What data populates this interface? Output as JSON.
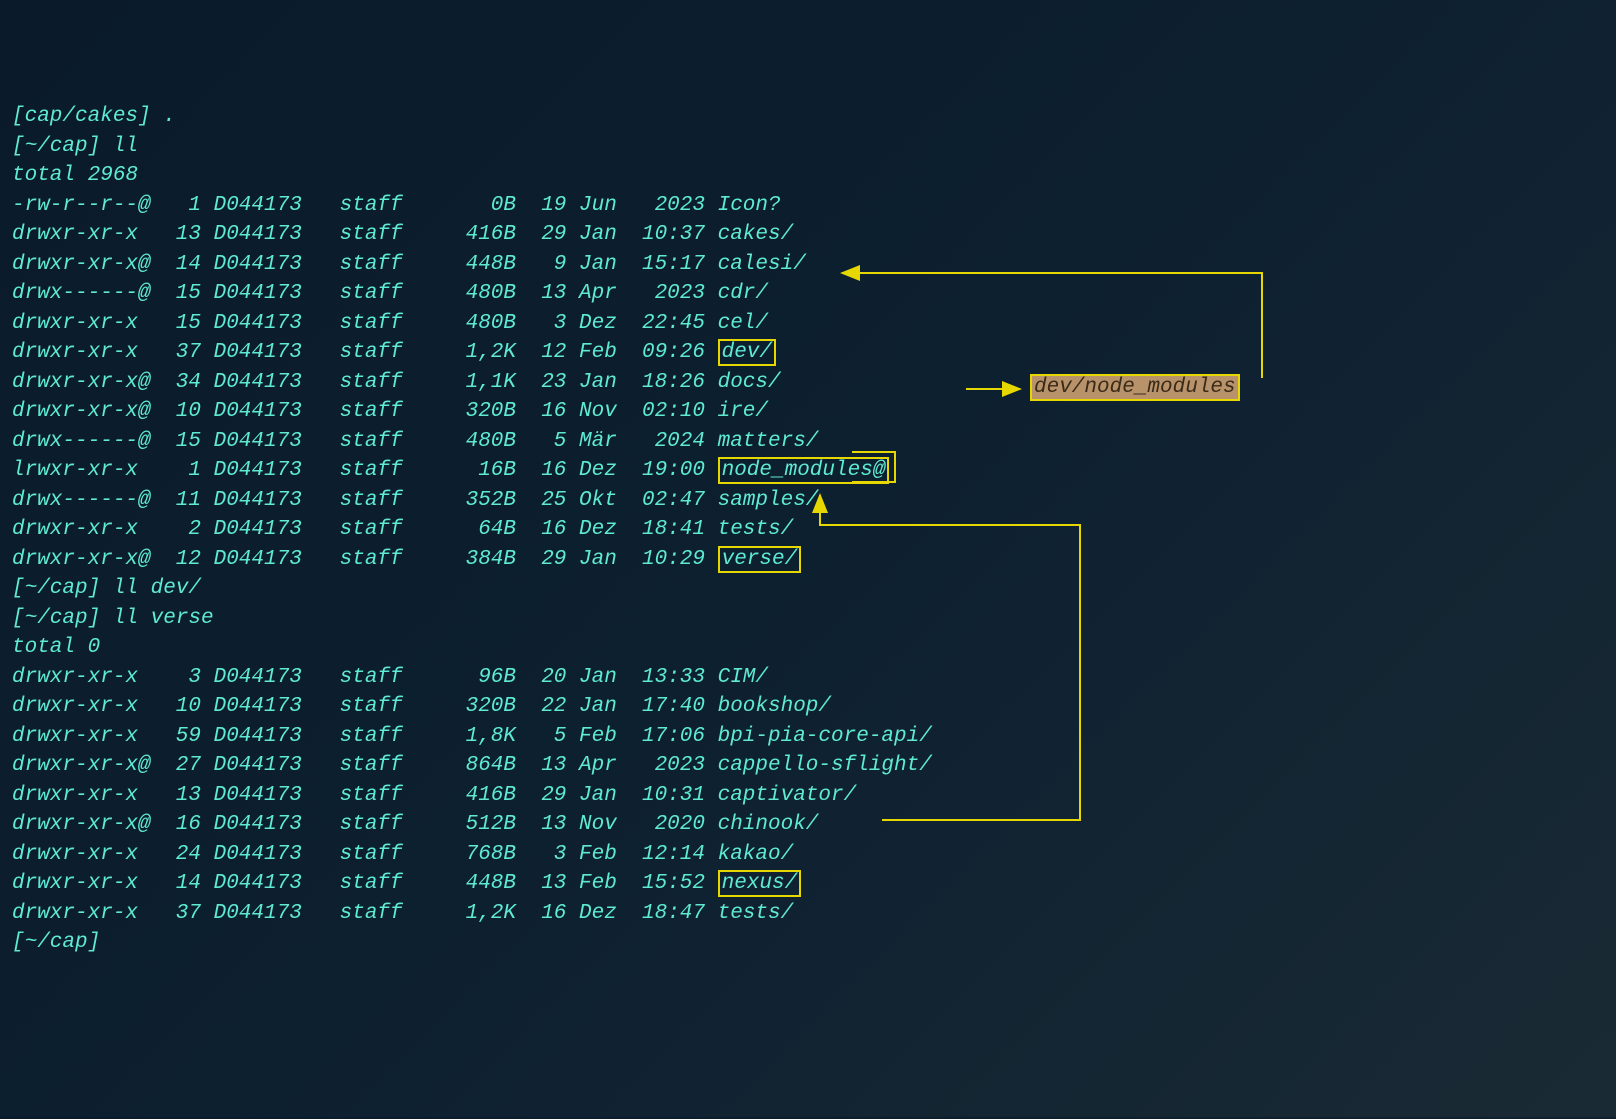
{
  "prompts": [
    "[cap/cakes] .",
    "[~/cap] ll",
    "total 2968",
    "[~/cap] ll dev/",
    "[~/cap] ll verse",
    "total 0",
    "[~/cap] "
  ],
  "symlink_target": "dev/node_modules",
  "arrow": "->",
  "list1": [
    {
      "perms": "-rw-r--r--@",
      "links": "1",
      "owner": "D044173",
      "group": "staff",
      "size": "0B",
      "day": "19",
      "mon": "Jun",
      "time": "2023",
      "name": "Icon?"
    },
    {
      "perms": "drwxr-xr-x",
      "links": "13",
      "owner": "D044173",
      "group": "staff",
      "size": "416B",
      "day": "29",
      "mon": "Jan",
      "time": "10:37",
      "name": "cakes/"
    },
    {
      "perms": "drwxr-xr-x@",
      "links": "14",
      "owner": "D044173",
      "group": "staff",
      "size": "448B",
      "day": "9",
      "mon": "Jan",
      "time": "15:17",
      "name": "calesi/"
    },
    {
      "perms": "drwx------@",
      "links": "15",
      "owner": "D044173",
      "group": "staff",
      "size": "480B",
      "day": "13",
      "mon": "Apr",
      "time": "2023",
      "name": "cdr/"
    },
    {
      "perms": "drwxr-xr-x",
      "links": "15",
      "owner": "D044173",
      "group": "staff",
      "size": "480B",
      "day": "3",
      "mon": "Dez",
      "time": "22:45",
      "name": "cel/"
    },
    {
      "perms": "drwxr-xr-x",
      "links": "37",
      "owner": "D044173",
      "group": "staff",
      "size": "1,2K",
      "day": "12",
      "mon": "Feb",
      "time": "09:26",
      "name": "dev/",
      "boxed": true
    },
    {
      "perms": "drwxr-xr-x@",
      "links": "34",
      "owner": "D044173",
      "group": "staff",
      "size": "1,1K",
      "day": "23",
      "mon": "Jan",
      "time": "18:26",
      "name": "docs/"
    },
    {
      "perms": "drwxr-xr-x@",
      "links": "10",
      "owner": "D044173",
      "group": "staff",
      "size": "320B",
      "day": "16",
      "mon": "Nov",
      "time": "02:10",
      "name": "ire/"
    },
    {
      "perms": "drwx------@",
      "links": "15",
      "owner": "D044173",
      "group": "staff",
      "size": "480B",
      "day": "5",
      "mon": "Mär",
      "time": "2024",
      "name": "matters/"
    },
    {
      "perms": "lrwxr-xr-x",
      "links": "1",
      "owner": "D044173",
      "group": "staff",
      "size": "16B",
      "day": "16",
      "mon": "Dez",
      "time": "19:00",
      "name": "node_modules@",
      "boxed": true,
      "symlink": true
    },
    {
      "perms": "drwx------@",
      "links": "11",
      "owner": "D044173",
      "group": "staff",
      "size": "352B",
      "day": "25",
      "mon": "Okt",
      "time": "02:47",
      "name": "samples/"
    },
    {
      "perms": "drwxr-xr-x",
      "links": "2",
      "owner": "D044173",
      "group": "staff",
      "size": "64B",
      "day": "16",
      "mon": "Dez",
      "time": "18:41",
      "name": "tests/"
    },
    {
      "perms": "drwxr-xr-x@",
      "links": "12",
      "owner": "D044173",
      "group": "staff",
      "size": "384B",
      "day": "29",
      "mon": "Jan",
      "time": "10:29",
      "name": "verse/",
      "boxed": true
    }
  ],
  "list2": [
    {
      "perms": "drwxr-xr-x",
      "links": "3",
      "owner": "D044173",
      "group": "staff",
      "size": "96B",
      "day": "20",
      "mon": "Jan",
      "time": "13:33",
      "name": "CIM/"
    },
    {
      "perms": "drwxr-xr-x",
      "links": "10",
      "owner": "D044173",
      "group": "staff",
      "size": "320B",
      "day": "22",
      "mon": "Jan",
      "time": "17:40",
      "name": "bookshop/"
    },
    {
      "perms": "drwxr-xr-x",
      "links": "59",
      "owner": "D044173",
      "group": "staff",
      "size": "1,8K",
      "day": "5",
      "mon": "Feb",
      "time": "17:06",
      "name": "bpi-pia-core-api/"
    },
    {
      "perms": "drwxr-xr-x@",
      "links": "27",
      "owner": "D044173",
      "group": "staff",
      "size": "864B",
      "day": "13",
      "mon": "Apr",
      "time": "2023",
      "name": "cappello-sflight/"
    },
    {
      "perms": "drwxr-xr-x",
      "links": "13",
      "owner": "D044173",
      "group": "staff",
      "size": "416B",
      "day": "29",
      "mon": "Jan",
      "time": "10:31",
      "name": "captivator/"
    },
    {
      "perms": "drwxr-xr-x@",
      "links": "16",
      "owner": "D044173",
      "group": "staff",
      "size": "512B",
      "day": "13",
      "mon": "Nov",
      "time": "2020",
      "name": "chinook/"
    },
    {
      "perms": "drwxr-xr-x",
      "links": "24",
      "owner": "D044173",
      "group": "staff",
      "size": "768B",
      "day": "3",
      "mon": "Feb",
      "time": "12:14",
      "name": "kakao/"
    },
    {
      "perms": "drwxr-xr-x",
      "links": "14",
      "owner": "D044173",
      "group": "staff",
      "size": "448B",
      "day": "13",
      "mon": "Feb",
      "time": "15:52",
      "name": "nexus/",
      "boxed": true
    },
    {
      "perms": "drwxr-xr-x",
      "links": "37",
      "owner": "D044173",
      "group": "staff",
      "size": "1,2K",
      "day": "16",
      "mon": "Dez",
      "time": "18:47",
      "name": "tests/"
    }
  ]
}
